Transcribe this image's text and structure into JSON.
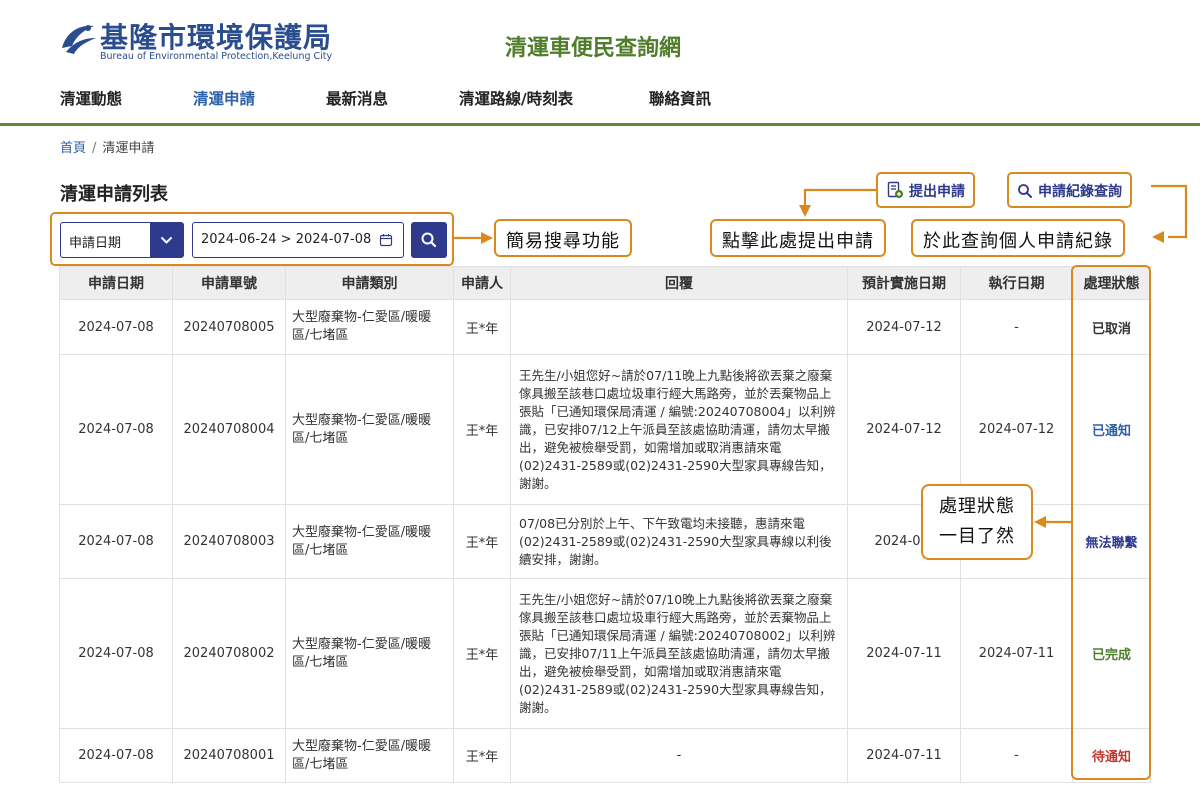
{
  "header": {
    "logo_cn": "基隆市環境保護局",
    "logo_en": "Bureau of Environmental Protection,Keelung City",
    "site_title": "清運車便民查詢網"
  },
  "nav": {
    "items": [
      {
        "label": "清運動態"
      },
      {
        "label": "清運申請"
      },
      {
        "label": "最新消息"
      },
      {
        "label": "清運路線/時刻表"
      },
      {
        "label": "聯絡資訊"
      }
    ],
    "active": "清運申請"
  },
  "breadcrumb": {
    "home": "首頁",
    "current": "清運申請"
  },
  "page_title": "清運申請列表",
  "search": {
    "filter_value": "申請日期",
    "date_range": "2024-06-24 > 2024-07-08"
  },
  "actions": {
    "submit_label": "提出申請",
    "records_label": "申請紀錄查詢"
  },
  "callouts": {
    "search": "簡易搜尋功能",
    "submit": "點擊此處提出申請",
    "records": "於此查詢個人申請紀錄",
    "status_line1": "處理狀態",
    "status_line2": "一目了然"
  },
  "colors": {
    "accent_orange": "#d98a1f",
    "brand_green": "#4f7d2c",
    "brand_navy": "#2e3a8c",
    "status_cancelled": "#333333",
    "status_notified": "#2e62a8",
    "status_unreachable": "#2e3a8c",
    "status_completed": "#4f7d2c",
    "status_pending": "#c0392b"
  },
  "table": {
    "headers": [
      "申請日期",
      "申請單號",
      "申請類別",
      "申請人",
      "回覆",
      "預計實施日期",
      "執行日期",
      "處理狀態"
    ],
    "rows": [
      {
        "date": "2024-07-08",
        "number": "20240708005",
        "category": "大型廢棄物-仁愛區/暖暖區/七堵區",
        "applicant": "王*年",
        "reply": "",
        "planned": "2024-07-12",
        "executed": "-",
        "status": "已取消",
        "status_color": "#333333"
      },
      {
        "date": "2024-07-08",
        "number": "20240708004",
        "category": "大型廢棄物-仁愛區/暖暖區/七堵區",
        "applicant": "王*年",
        "reply": "王先生/小姐您好~請於07/11晚上九點後將欲丟棄之廢棄傢具搬至該巷口處垃圾車行經大馬路旁，並於丟棄物品上張貼「已通知環保局清運 / 編號:20240708004」以利辨識，已安排07/12上午派員至該處協助清運，請勿太早搬出，避免被檢舉受罰，如需增加或取消惠請來電(02)2431-2589或(02)2431-2590大型家具專線告知，謝謝。",
        "planned": "2024-07-12",
        "executed": "2024-07-12",
        "status": "已通知",
        "status_color": "#2e62a8"
      },
      {
        "date": "2024-07-08",
        "number": "20240708003",
        "category": "大型廢棄物-仁愛區/暖暖區/七堵區",
        "applicant": "王*年",
        "reply": "07/08已分別於上午、下午致電均未接聽，惠請來電(02)2431-2589或(02)2431-2590大型家具專線以利後續安排，謝謝。",
        "planned": "2024-07-",
        "executed": "",
        "status": "無法聯繫",
        "status_color": "#2e3a8c"
      },
      {
        "date": "2024-07-08",
        "number": "20240708002",
        "category": "大型廢棄物-仁愛區/暖暖區/七堵區",
        "applicant": "王*年",
        "reply": "王先生/小姐您好~請於07/10晚上九點後將欲丟棄之廢棄傢具搬至該巷口處垃圾車行經大馬路旁，並於丟棄物品上張貼「已通知環保局清運 / 編號:20240708002」以利辨識，已安排07/11上午派員至該處協助清運，請勿太早搬出，避免被檢舉受罰，如需增加或取消惠請來電(02)2431-2589或(02)2431-2590大型家具專線告知，謝謝。",
        "planned": "2024-07-11",
        "executed": "2024-07-11",
        "status": "已完成",
        "status_color": "#4f7d2c"
      },
      {
        "date": "2024-07-08",
        "number": "20240708001",
        "category": "大型廢棄物-仁愛區/暖暖區/七堵區",
        "applicant": "王*年",
        "reply": "-",
        "planned": "2024-07-11",
        "executed": "-",
        "status": "待通知",
        "status_color": "#c0392b"
      }
    ]
  }
}
